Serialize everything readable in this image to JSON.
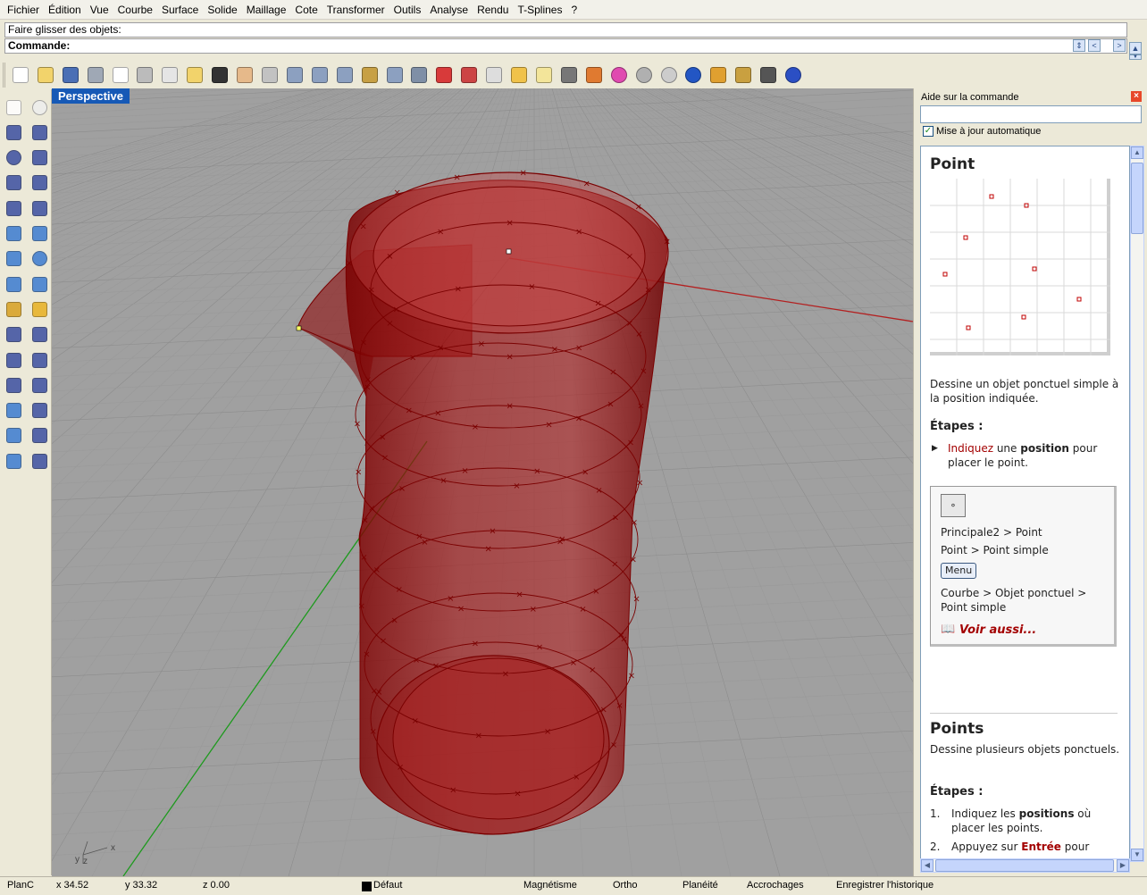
{
  "menu": [
    "Fichier",
    "Édition",
    "Vue",
    "Courbe",
    "Surface",
    "Solide",
    "Maillage",
    "Cote",
    "Transformer",
    "Outils",
    "Analyse",
    "Rendu",
    "T-Splines",
    "?"
  ],
  "command": {
    "history": "Faire glisser des objets:",
    "prompt": "Commande:"
  },
  "toolbar_icons": [
    "new-icon",
    "open-icon",
    "save-icon",
    "print-icon",
    "export-icon",
    "cut-icon",
    "copy-icon",
    "paste-icon",
    "undo-icon",
    "pan-icon",
    "rotate-view-icon",
    "zoom-icon",
    "zoom-window-icon",
    "zoom-extents-icon",
    "zoom-selected-icon",
    "undo-view-icon",
    "four-viewports-icon",
    "car-icon",
    "grid-car-icon",
    "cplane-icon",
    "osnap-icon",
    "lightbulb-icon",
    "lock-icon",
    "layer-icon",
    "color-wheel-icon",
    "shade-icon",
    "render-sphere-icon",
    "blue-sphere-icon",
    "properties-icon",
    "gear-icon",
    "history-icon",
    "help-icon"
  ],
  "side_icons": [
    "select-icon",
    "point-icon",
    "polyline-icon",
    "curve-icon",
    "circle-icon",
    "ellipse-icon",
    "polygon-icon",
    "rectangle-icon",
    "arc-icon",
    "fillet-icon",
    "surface-icon",
    "sweep-icon",
    "box-icon",
    "sphere-icon",
    "cylinder-icon",
    "plane-icon",
    "explode-icon",
    "boolean-icon",
    "trim-icon",
    "split-icon",
    "group-icon",
    "array-icon",
    "curve-offset-icon",
    "move-icon",
    "text-icon",
    "scale-icon",
    "transform-icon",
    "dimension-icon",
    "block-icon",
    "measure-icon"
  ],
  "viewport": {
    "title": "Perspective",
    "axis_labels": {
      "x": "x",
      "y": "y",
      "z": "z"
    }
  },
  "help": {
    "title": "Aide sur la commande",
    "close": "×",
    "autoupdate_label": "Mise à jour automatique",
    "autoupdate_checked": "✓",
    "heading": "Point",
    "desc": "Dessine un objet ponctuel simple à la position indiquée.",
    "steps_heading": "Étapes :",
    "step1_prefix": "Indiquez",
    "step1_mid": " une ",
    "step1_bold": "position",
    "step1_suffix": " pour placer le point.",
    "cmd_box": {
      "icon": "∘",
      "line1": "Principale2 > Point",
      "line2": "Point > Point simple",
      "menu_button": "Menu",
      "line3": "Courbe > Objet ponctuel >",
      "line4": "Point simple",
      "see_also": "Voir aussi..."
    },
    "heading2": "Points",
    "desc2": "Dessine plusieurs objets ponctuels.",
    "steps_heading2": "Étapes :",
    "s2_1_num": "1.",
    "s2_1_a": "Indiquez les ",
    "s2_1_b": "positions",
    "s2_1_c": " où placer les points.",
    "s2_2_num": "2.",
    "s2_2_a": "Appuyez sur ",
    "s2_2_b": "Entrée",
    "s2_2_c": " pour"
  },
  "status": {
    "cplane": "PlanC",
    "x": "x 34.52",
    "y": "y 33.32",
    "z": "z 0.00",
    "layer": "Défaut",
    "snap": "Magnétisme",
    "ortho": "Ortho",
    "planar": "Planéité",
    "osnap": "Accrochages",
    "history": "Enregistrer l'historique"
  },
  "colors": {
    "object_red": "#8B0000",
    "viewport_bg": "#A0A0A0",
    "title_blue": "#1659B6"
  }
}
